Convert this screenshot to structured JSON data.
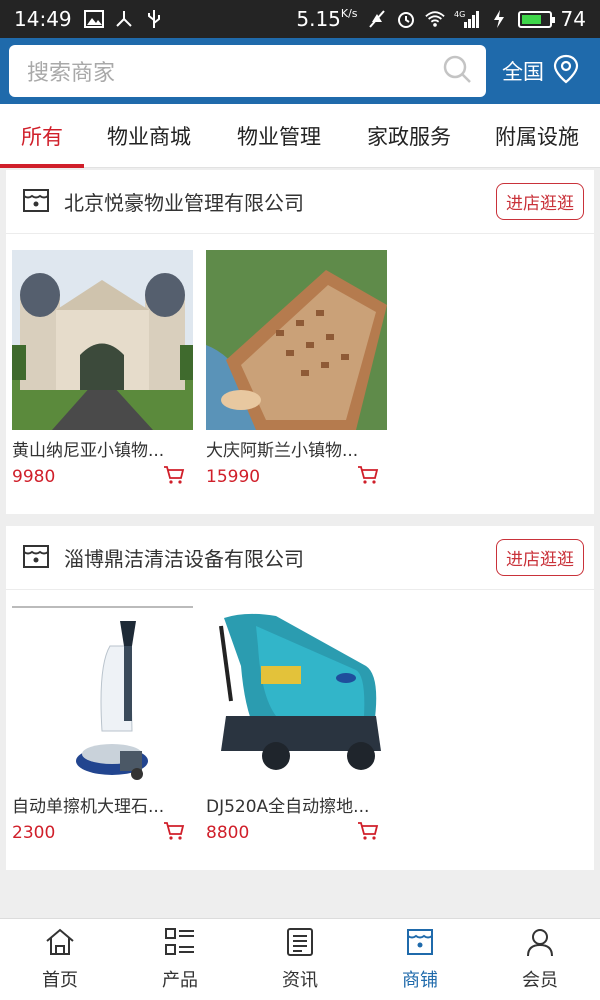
{
  "status_bar": {
    "time": "14:49",
    "speed": "5.15",
    "speed_unit": "K/s",
    "network": "4G",
    "battery": "74",
    "battery_level": 0.74
  },
  "search": {
    "placeholder": "搜索商家"
  },
  "region": {
    "label": "全国"
  },
  "tabs": [
    {
      "label": "所有",
      "active": true
    },
    {
      "label": "物业商城"
    },
    {
      "label": "物业管理"
    },
    {
      "label": "家政服务"
    },
    {
      "label": "附属设施"
    }
  ],
  "stores": [
    {
      "name": "北京悦豪物业管理有限公司",
      "visit_label": "进店逛逛",
      "products": [
        {
          "title": "黄山纳尼亚小镇物...",
          "price": "9980"
        },
        {
          "title": "大庆阿斯兰小镇物...",
          "price": "15990"
        }
      ]
    },
    {
      "name": "淄博鼎洁清洁设备有限公司",
      "visit_label": "进店逛逛",
      "products": [
        {
          "title": "自动单擦机大理石...",
          "price": "2300"
        },
        {
          "title": "DJ520A全自动擦地...",
          "price": "8800"
        }
      ]
    }
  ],
  "bottom_nav": [
    {
      "label": "首页",
      "icon": "home-icon"
    },
    {
      "label": "产品",
      "icon": "grid-list-icon"
    },
    {
      "label": "资讯",
      "icon": "news-icon"
    },
    {
      "label": "商铺",
      "icon": "store-icon",
      "active": true
    },
    {
      "label": "会员",
      "icon": "user-icon"
    }
  ],
  "colors": {
    "brand_blue": "#1f6aab",
    "accent_red": "#d01f2a"
  }
}
